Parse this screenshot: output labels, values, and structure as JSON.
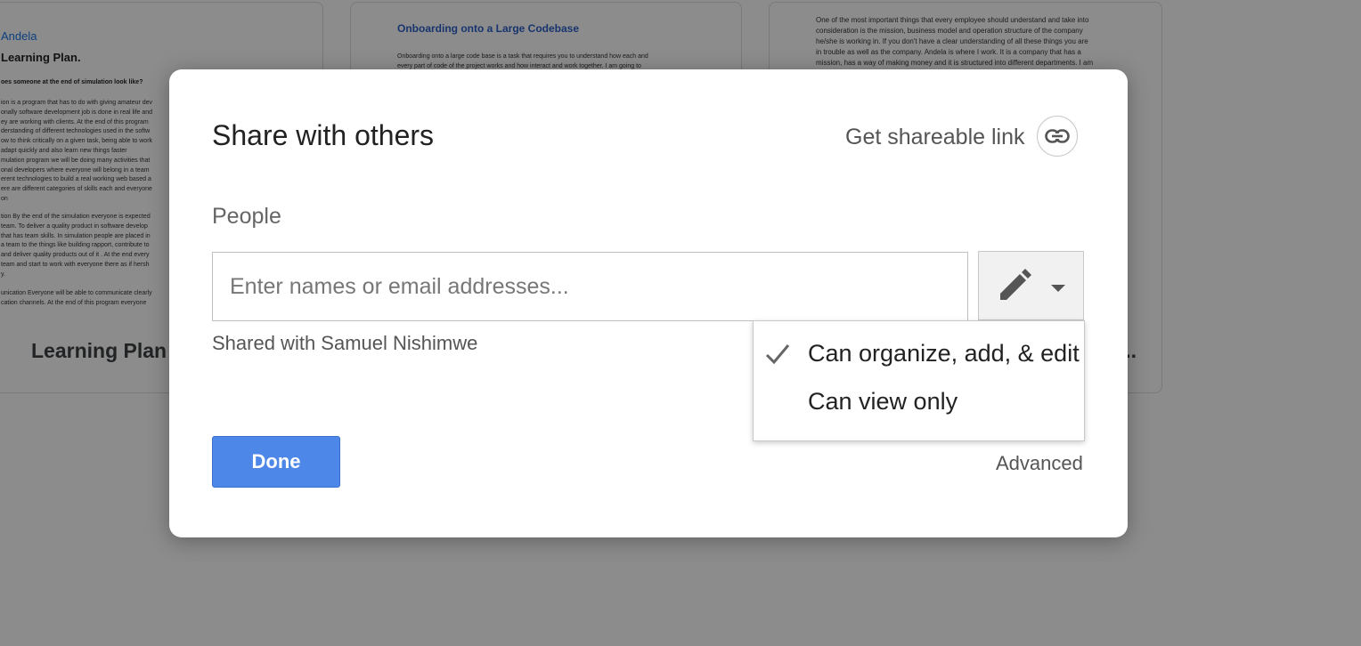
{
  "background": {
    "cards": [
      {
        "brand": "Andela",
        "title": "Learning Plan.",
        "heading": "oes someone at the end of simulation look like?",
        "paragraph1": "ion is a program that has to do with giving amateur dev\nonally software development job is done in real life and\ney are working with clients. At the end of this program\nderstanding of different technologies used in the softw\now to think critically on a given task, being able to work\nadapt quickly and also learn new things faster\nmulation program we will be doing many activities that\nonal developers where everyone will belong in a team\nerent technologies to build a real working web based a\nere are different categories of skills each and everyone\non",
        "paragraph2": "tion By the end of the simulation everyone is expected\n team. To deliver a quality product in software develop\nthat has team skills. In simulation people are placed in\na team to the things like building rapport, contribute to\n and deliver quality products out of it . At the end every\n team and start to work with everyone there as if hersh\ny.",
        "paragraph3": "unication Everyone will be able to communicate clearly\ncation channels. At the end of this program everyone",
        "card_title": "Learning Plan"
      },
      {
        "heading": "Onboarding onto a Large Codebase",
        "paragraph": "Onboarding onto a large code base is a task that requires you to understand how each and\nevery part of code of the project works and how interact and work together. I am going to"
      },
      {
        "paragraph": "One of the most important things that every employee should understand and take into\nconsideration is the mission, business model and operation structure of the company\nhe/she is working in. If you don't have a clear understanding of all these things you are\nin trouble as well as the company. Andela is where I work. It is a company that has a\nmission, has a way of making money and it is structured into different departments. I am",
        "card_title_tail": "..."
      }
    ]
  },
  "dialog": {
    "title": "Share with others",
    "shareable_link": "Get shareable link",
    "people_label": "People",
    "people_input": {
      "placeholder": "Enter names or email addresses...",
      "value": ""
    },
    "shared_with": "Shared with Samuel Nishimwe",
    "permission_menu": {
      "options": [
        {
          "label": "Can organize, add, & edit",
          "selected": true
        },
        {
          "label": "Can view only",
          "selected": false
        }
      ]
    },
    "done_label": "Done",
    "advanced_label": "Advanced"
  },
  "colors": {
    "primary_button": "#4d88e8",
    "scrim": "rgba(0,0,0,0.45)",
    "link_blue": "#1a73e8"
  },
  "icons": [
    "link-icon",
    "pencil-icon",
    "chevron-down-icon",
    "checkmark-icon"
  ]
}
